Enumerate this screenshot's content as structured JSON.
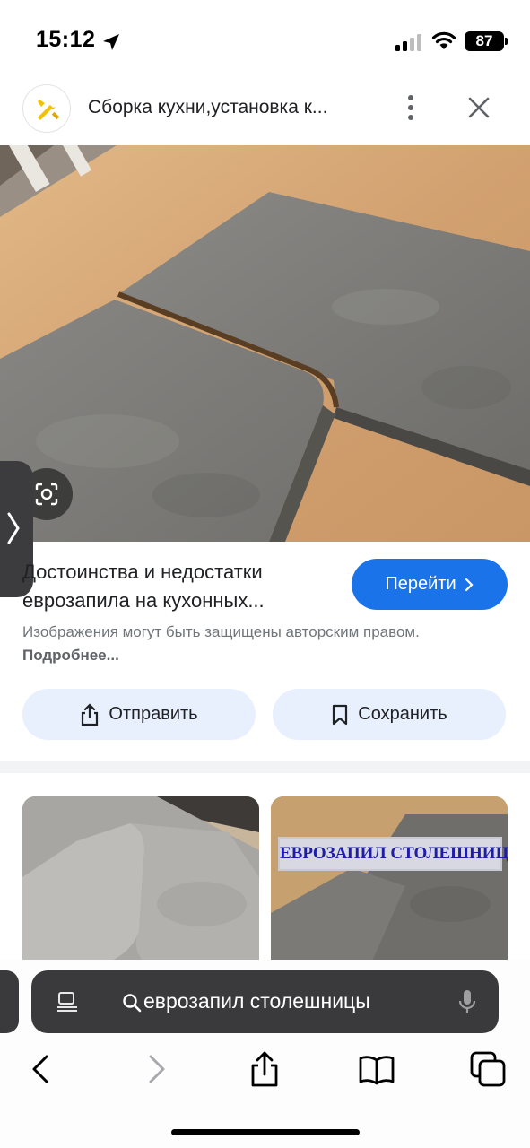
{
  "status_bar": {
    "time": "15:12",
    "battery": "87",
    "icons": [
      "location-arrow-icon",
      "cellular-signal-icon",
      "wifi-icon",
      "battery-icon"
    ]
  },
  "header": {
    "title": "Сборка кухни,установка к...",
    "logo_icon": "tools-logo-icon",
    "more_icon": "more-vert-icon",
    "close_icon": "close-icon"
  },
  "result": {
    "title_line1": "Достоинства и недостатки",
    "title_line2": "еврозапила на кухонных...",
    "go_button": "Перейти",
    "copyright_text": "Изображения могут быть защищены авторским правом.",
    "more_link": "Подробнее...",
    "share_button": "Отправить",
    "save_button": "Сохранить"
  },
  "related": {
    "right_caption": "ЕВРОЗАПИЛ СТОЛЕШНИЦ"
  },
  "browser": {
    "address_text": "еврозапил столешницы",
    "toolbar_icons": [
      "back-icon",
      "forward-icon",
      "share-icon",
      "bookmarks-icon",
      "tabs-icon"
    ]
  },
  "colors": {
    "accent": "#1a73e8",
    "action_button_bg": "#e8f0fe",
    "address_bar_bg": "#3a3a3c",
    "countertop_gray": "#7d7c78",
    "table_wood": "#d6a774"
  }
}
